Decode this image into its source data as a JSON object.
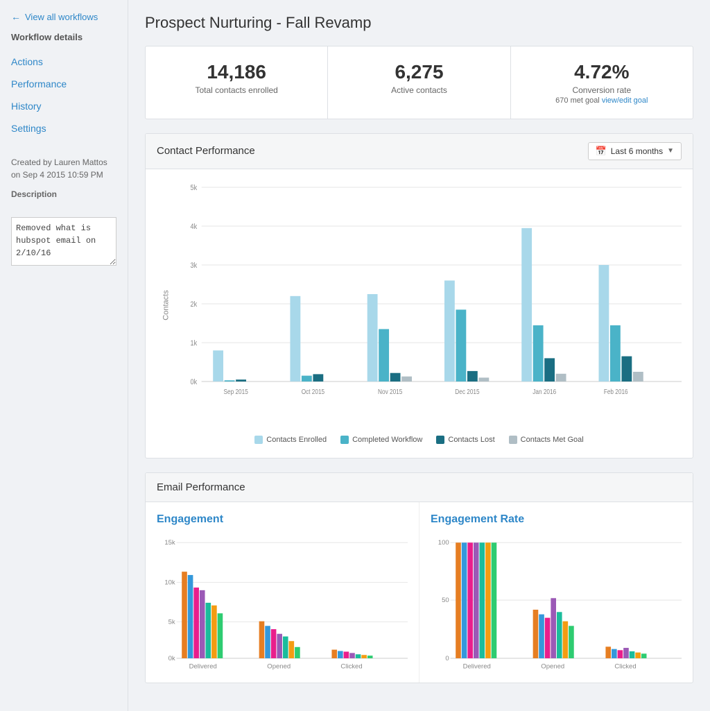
{
  "sidebar": {
    "back_label": "View all workflows",
    "section_title": "Workflow details",
    "nav_items": [
      {
        "label": "Actions",
        "href": "#"
      },
      {
        "label": "Performance",
        "href": "#"
      },
      {
        "label": "History",
        "href": "#"
      },
      {
        "label": "Settings",
        "href": "#"
      }
    ],
    "meta": {
      "created_by_label": "Created by Lauren Mattos",
      "created_on": "on Sep 4 2015 10:59 PM",
      "description_label": "Description",
      "description_text": "Removed what is hubspot email on 2/10/16"
    }
  },
  "page": {
    "title": "Prospect Nurturing - Fall Revamp"
  },
  "stats": [
    {
      "value": "14,186",
      "label": "Total contacts enrolled"
    },
    {
      "value": "6,275",
      "label": "Active contacts"
    },
    {
      "value": "4.72%",
      "label": "Conversion rate",
      "sub": "670 met goal",
      "link": "view/edit goal"
    }
  ],
  "contact_performance": {
    "title": "Contact Performance",
    "date_filter": "Last 6 months",
    "legend": [
      {
        "label": "Contacts Enrolled",
        "color": "#a8d8ea"
      },
      {
        "label": "Completed Workflow",
        "color": "#4ab3c8"
      },
      {
        "label": "Contacts Lost",
        "color": "#1a6e82"
      },
      {
        "label": "Contacts Met Goal",
        "color": "#b0bec5"
      }
    ],
    "y_axis_labels": [
      "0k",
      "1k",
      "2k",
      "3k",
      "4k",
      "5k"
    ],
    "months": [
      "Sep 2015",
      "Oct 2015",
      "Nov 2015",
      "Dec 2015",
      "Jan 2016",
      "Feb 2016"
    ],
    "bars": [
      {
        "enrolled": 800,
        "completed": 30,
        "lost": 50,
        "met_goal": 0
      },
      {
        "enrolled": 2200,
        "completed": 150,
        "lost": 190,
        "met_goal": 0
      },
      {
        "enrolled": 2250,
        "completed": 1350,
        "lost": 220,
        "met_goal": 130
      },
      {
        "enrolled": 2600,
        "completed": 1850,
        "lost": 270,
        "met_goal": 100
      },
      {
        "enrolled": 3950,
        "completed": 1450,
        "lost": 600,
        "met_goal": 200
      },
      {
        "enrolled": 3000,
        "completed": 1450,
        "lost": 650,
        "met_goal": 250
      }
    ]
  },
  "email_performance": {
    "title": "Email Performance",
    "engagement": {
      "title": "Engagement",
      "y_labels": [
        "0k",
        "5k",
        "10k",
        "15k"
      ],
      "x_labels": [
        "Delivered",
        "Opened",
        "Clicked",
        ""
      ],
      "series": [
        {
          "color": "#e67e22",
          "values": [
            11200,
            4800,
            1100
          ]
        },
        {
          "color": "#3498db",
          "values": [
            10800,
            4200,
            900
          ]
        },
        {
          "color": "#e91e8c",
          "values": [
            9200,
            3800,
            800
          ]
        },
        {
          "color": "#9b59b6",
          "values": [
            8800,
            3200,
            650
          ]
        },
        {
          "color": "#1abc9c",
          "values": [
            7200,
            2800,
            500
          ]
        },
        {
          "color": "#f39c12",
          "values": [
            6800,
            2200,
            420
          ]
        },
        {
          "color": "#2ecc71",
          "values": [
            5800,
            1500,
            350
          ]
        }
      ]
    },
    "engagement_rate": {
      "title": "Engagement Rate",
      "y_labels": [
        "0",
        "50",
        "100"
      ],
      "x_labels": [
        "Delivered",
        "Opened",
        "Clicked",
        ""
      ],
      "series": [
        {
          "color": "#e67e22",
          "values": [
            100,
            42,
            10
          ]
        },
        {
          "color": "#3498db",
          "values": [
            100,
            38,
            8
          ]
        },
        {
          "color": "#e91e8c",
          "values": [
            100,
            35,
            7
          ]
        },
        {
          "color": "#9b59b6",
          "values": [
            100,
            52,
            9
          ]
        },
        {
          "color": "#1abc9c",
          "values": [
            100,
            40,
            6
          ]
        },
        {
          "color": "#f39c12",
          "values": [
            100,
            32,
            5
          ]
        },
        {
          "color": "#2ecc71",
          "values": [
            100,
            28,
            4
          ]
        }
      ]
    }
  }
}
